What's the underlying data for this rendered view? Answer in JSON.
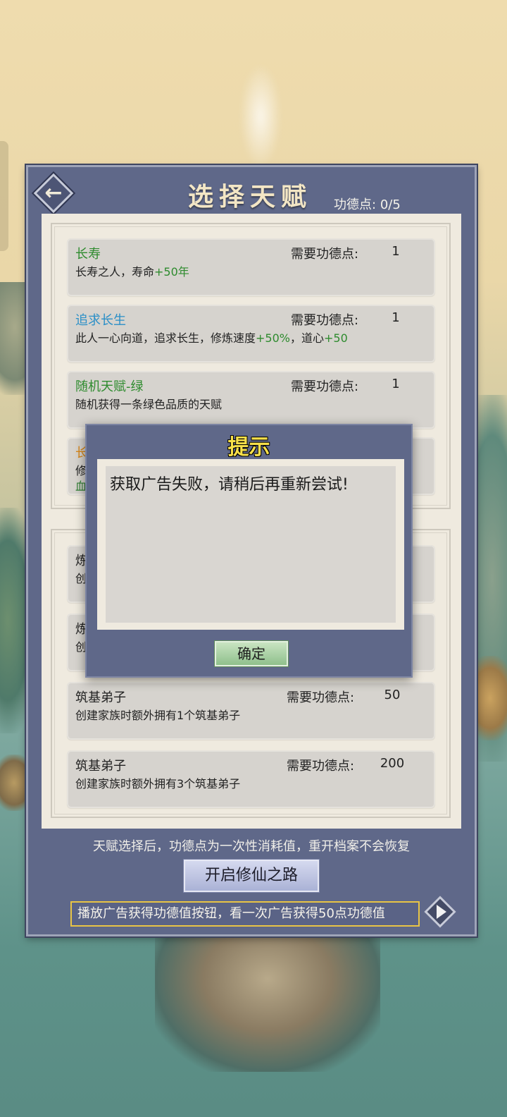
{
  "header": {
    "title": "选择天赋",
    "merit_label": "功德点:",
    "merit_value": "0/5"
  },
  "talents_group1": [
    {
      "name": "长寿",
      "name_color": "green",
      "cost_label": "需要功德点:",
      "cost": "1",
      "desc_pre": "长寿之人，寿命",
      "desc_hl": "+50年"
    },
    {
      "name": "追求长生",
      "name_color": "blue",
      "cost_label": "需要功德点:",
      "cost": "1",
      "desc_pre": "此人一心向道，追求长生，修炼速度",
      "desc_hl": "+50%",
      "desc_mid": "，道心",
      "desc_hl2": "+50"
    },
    {
      "name": "随机天赋-绿",
      "name_color": "green",
      "cost_label": "需要功德点:",
      "cost": "1",
      "desc_pre": "随机获得一条绿色品质的天赋"
    },
    {
      "name": "长",
      "name_color": "orange",
      "desc_pre": "修",
      "desc_line2": "血"
    }
  ],
  "talents_group2": [
    {
      "name": "炼",
      "desc_pre": "创"
    },
    {
      "name": "炼",
      "desc_pre": "创"
    },
    {
      "name": "筑基弟子",
      "cost_label": "需要功德点:",
      "cost": "50",
      "desc_pre": "创建家族时额外拥有1个筑基弟子"
    },
    {
      "name": "筑基弟子",
      "cost_label": "需要功德点:",
      "cost": "200",
      "desc_pre": "创建家族时额外拥有3个筑基弟子"
    }
  ],
  "footer": {
    "note": "天赋选择后，功德点为一次性消耗值，重开档案不会恢复",
    "start_button": "开启修仙之路",
    "ad_text": "播放广告获得功德值按钮，看一次广告获得50点功德值"
  },
  "modal": {
    "title": "提示",
    "message": "获取广告失败，请稍后再重新尝试!",
    "ok_button": "确定"
  },
  "icons": {
    "back": "arrow-left-icon",
    "play": "play-icon"
  },
  "colors": {
    "panel": "#5f6889",
    "green_text": "#2e8b2e",
    "blue_text": "#2a8fc7",
    "orange_text": "#d9881a",
    "modal_title": "#f7e04a"
  }
}
